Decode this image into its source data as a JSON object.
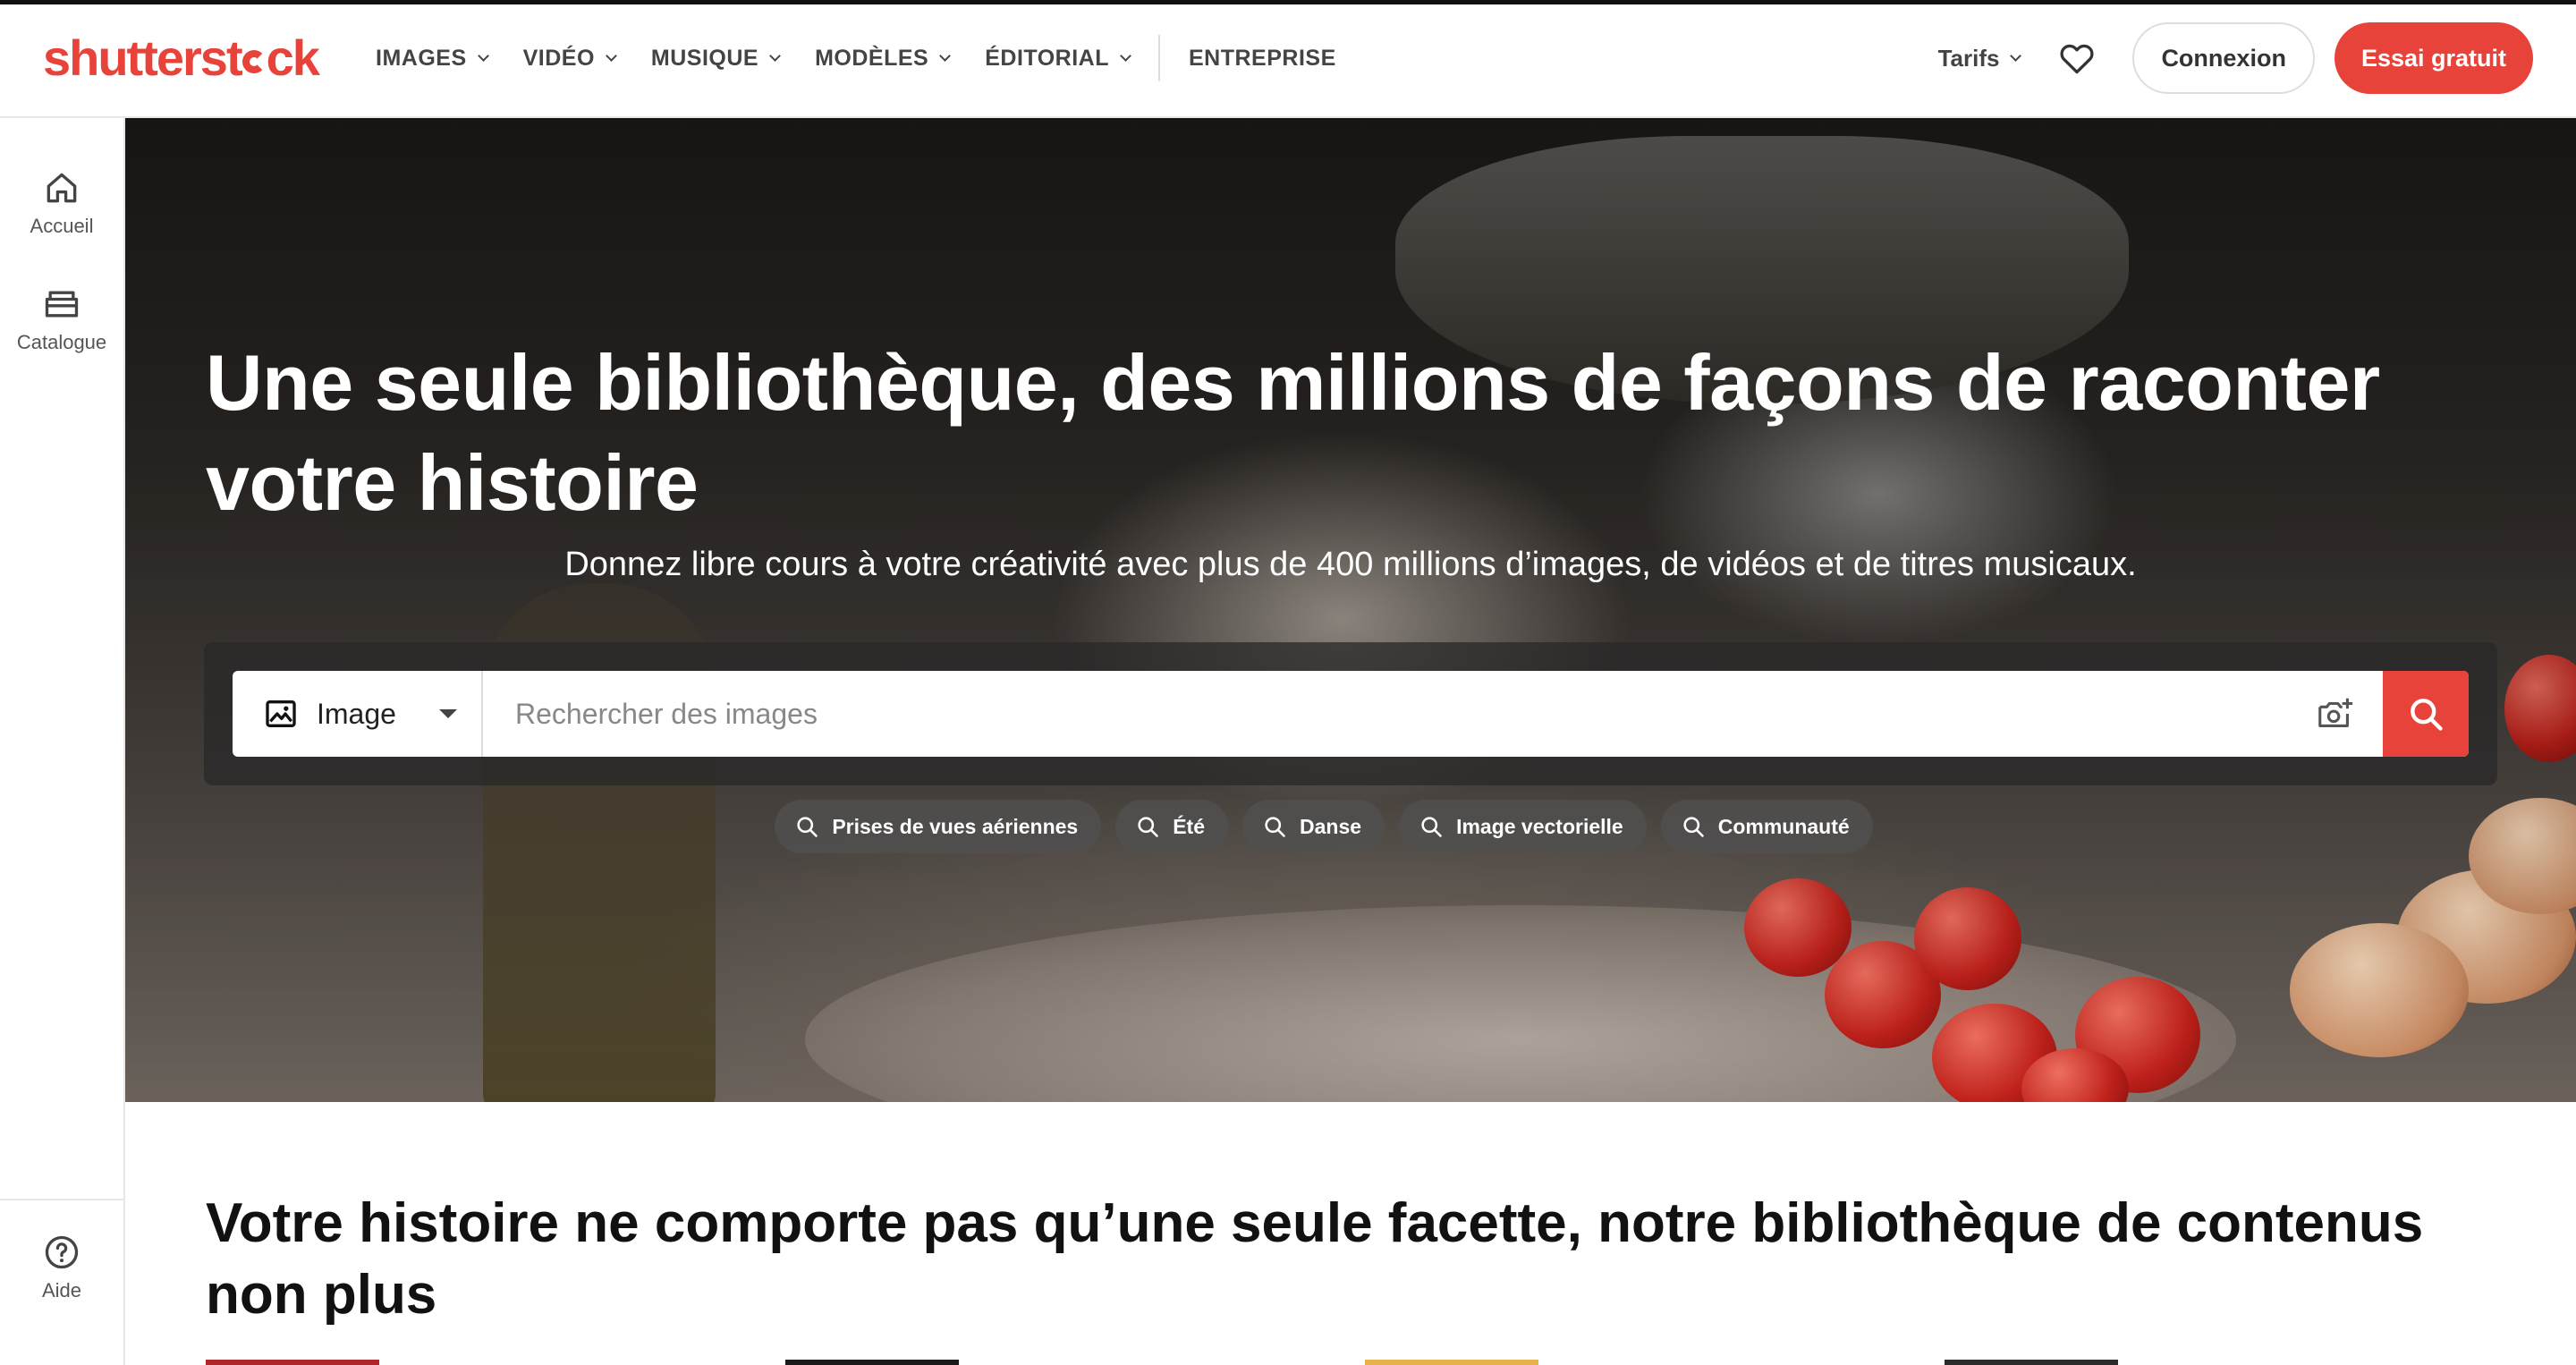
{
  "brand": {
    "logo_text_a": "shutterst",
    "logo_text_b": "ck",
    "accent": "#e8433a"
  },
  "nav": {
    "items": [
      {
        "label": "IMAGES"
      },
      {
        "label": "VIDÉO"
      },
      {
        "label": "MUSIQUE"
      },
      {
        "label": "MODÈLES"
      },
      {
        "label": "ÉDITORIAL"
      }
    ],
    "enterprise": "ENTREPRISE",
    "pricing": "Tarifs",
    "login": "Connexion",
    "trial": "Essai gratuit"
  },
  "sidebar": {
    "home": "Accueil",
    "catalog": "Catalogue",
    "help": "Aide"
  },
  "hero": {
    "title": "Une seule bibliothèque, des millions de façons de raconter votre histoire",
    "subtitle": "Donnez libre cours à votre créativité avec plus de 400 millions d’images, de vidéos et de titres musicaux.",
    "search": {
      "type_label": "Image",
      "placeholder": "Rechercher des images"
    },
    "chips": [
      {
        "label": "Prises de vues aériennes"
      },
      {
        "label": "Été"
      },
      {
        "label": "Danse"
      },
      {
        "label": "Image vectorielle"
      },
      {
        "label": "Communauté"
      }
    ]
  },
  "section": {
    "title": "Votre histoire ne comporte pas qu’une seule facette, notre bibliothèque de contenus non plus"
  }
}
